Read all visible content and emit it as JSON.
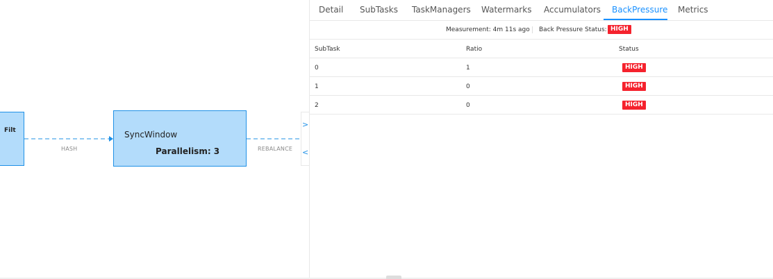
{
  "graph": {
    "nodes": [
      {
        "name": "Filt"
      },
      {
        "name": "SyncWindow",
        "parallelism": "Parallelism: 3"
      }
    ],
    "edges": {
      "hash": "HASH",
      "rebalance": "REBALANCE"
    },
    "toggle": {
      "expand": ">",
      "collapse": "<"
    }
  },
  "tabs": [
    "Detail",
    "SubTasks",
    "TaskManagers",
    "Watermarks",
    "Accumulators",
    "BackPressure",
    "Metrics"
  ],
  "active_tab": "BackPressure",
  "measurement": {
    "label": "Measurement: 4m 11s ago",
    "status_label": "Back Pressure Status:",
    "status": "HIGH",
    "status_color": "#f5222d"
  },
  "table": {
    "headers": [
      "SubTask",
      "Ratio",
      "Status"
    ],
    "rows": [
      {
        "subtask": "0",
        "ratio": "1",
        "status": "HIGH"
      },
      {
        "subtask": "1",
        "ratio": "0",
        "status": "HIGH"
      },
      {
        "subtask": "2",
        "ratio": "0",
        "status": "HIGH"
      }
    ]
  },
  "colors": {
    "accent": "#1890ff",
    "node_fill": "#b3dcfb",
    "node_border": "#1f90e6",
    "high": "#f5222d"
  }
}
